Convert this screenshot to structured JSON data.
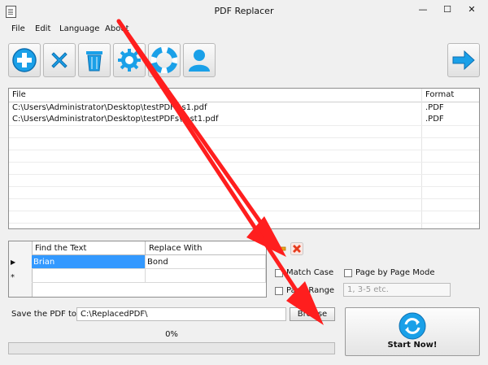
{
  "window": {
    "title": "PDF Replacer",
    "minimize": "—",
    "maximize": "☐",
    "close": "✕"
  },
  "menu": [
    "File",
    "Edit",
    "Language",
    "About"
  ],
  "toolbar": {
    "buttons": [
      {
        "name": "add-files-button",
        "icon": "plus-icon"
      },
      {
        "name": "remove-file-button",
        "icon": "x-icon"
      },
      {
        "name": "clear-list-button",
        "icon": "trash-icon"
      },
      {
        "name": "settings-button",
        "icon": "gear-icon"
      },
      {
        "name": "help-button",
        "icon": "lifebuoy-icon"
      },
      {
        "name": "account-button",
        "icon": "user-icon"
      }
    ],
    "next": {
      "name": "next-button",
      "icon": "arrow-right-icon"
    }
  },
  "file_list": {
    "col_file": "File",
    "col_format": "Format",
    "rows": [
      {
        "file": "C:\\Users\\Administrator\\Desktop\\testPDFs\\s1.pdf",
        "format": ".PDF"
      },
      {
        "file": "C:\\Users\\Administrator\\Desktop\\testPDFs\\test1.pdf",
        "format": ".PDF"
      }
    ]
  },
  "replace_grid": {
    "col_find": "Find the Text",
    "col_replace": "Replace With",
    "rows": [
      {
        "marker": "▶",
        "find": "Brian",
        "replace": "Bond"
      },
      {
        "marker": "*",
        "find": "",
        "replace": ""
      }
    ]
  },
  "options": {
    "match_case": "Match Case",
    "page_by_page": "Page by Page Mode",
    "page_range": "Page Range",
    "range_placeholder": "1, 3-5 etc."
  },
  "save": {
    "label": "Save the PDF to",
    "path": "C:\\ReplacedPDF\\",
    "browse": "Browse"
  },
  "progress": {
    "percent_text": "0%",
    "value": 0
  },
  "start": {
    "label": "Start Now!"
  },
  "colors": {
    "accent": "#1aa0e8",
    "danger": "#e63c1e",
    "annotation": "#ff1e1e"
  }
}
